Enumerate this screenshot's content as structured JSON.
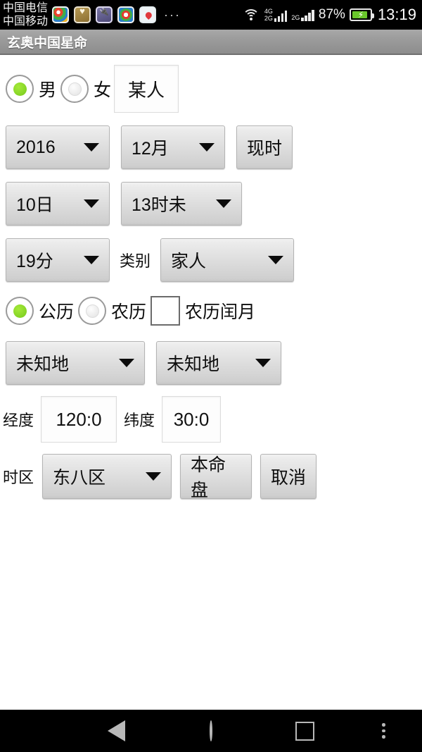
{
  "status_bar": {
    "carrier_line1": "中国电信",
    "carrier_line2": "中国移动",
    "more_icon": "···",
    "sim1_label_top": "4G",
    "sim1_label_bottom": "2G",
    "sim2_label_top": "2G",
    "battery_percent": "87%",
    "clock": "13:19",
    "notification_icons": [
      "ball-icon",
      "health-icon",
      "usb-icon",
      "browser-icon",
      "location-pin-icon"
    ],
    "wifi_icon": "wifi-icon",
    "battery_icon": "battery-charging-icon"
  },
  "title_bar": {
    "title": "玄奥中国星命"
  },
  "form": {
    "gender": {
      "male_label": "男",
      "female_label": "女",
      "selected": "男",
      "name_value": "某人"
    },
    "date": {
      "year": "2016",
      "month": "12月",
      "now_button": "现时",
      "day": "10日",
      "hour": "13时未",
      "minute": "19分"
    },
    "category": {
      "label": "类别",
      "value": "家人"
    },
    "calendar": {
      "solar_label": "公历",
      "lunar_label": "农历",
      "selected": "公历",
      "leap_month_label": "农历闰月",
      "leap_month_checked": false
    },
    "location": {
      "province": "未知地",
      "city": "未知地",
      "longitude_label": "经度",
      "longitude_value": "120:0",
      "latitude_label": "纬度",
      "latitude_value": "30:0",
      "timezone_label": "时区",
      "timezone_value": "东八区"
    },
    "actions": {
      "submit": "本命盘",
      "cancel": "取消"
    }
  },
  "nav_bar": {
    "back_icon": "back-triangle-icon",
    "home_icon": "home-circle-icon",
    "recents_icon": "recents-square-icon",
    "menu_icon": "overflow-menu-icon"
  },
  "colors": {
    "accent_green": "#7fd321",
    "title_bar_gray": "#9a9a9a",
    "button_gray": "#dcdcdc",
    "nav_icon_gray": "#b8b8b8"
  }
}
